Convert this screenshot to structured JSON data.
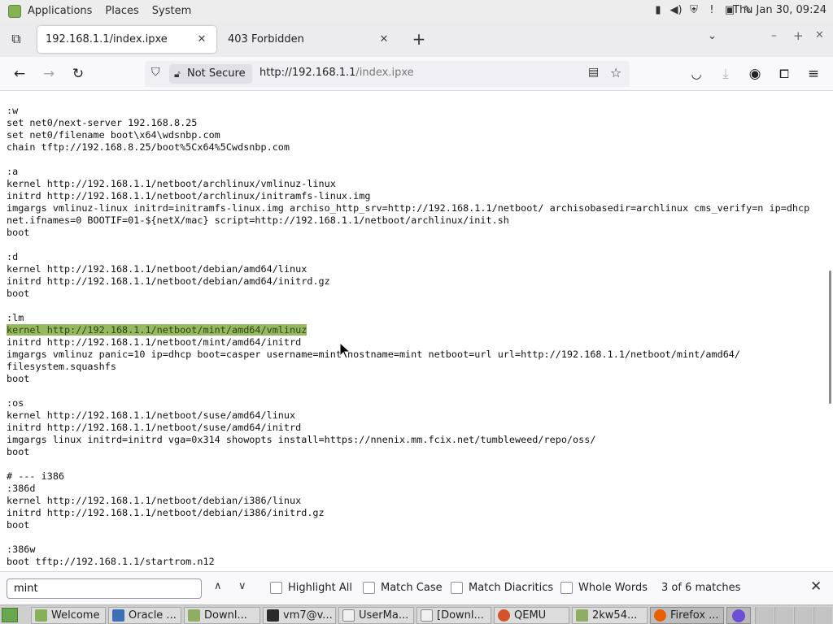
{
  "top_panel": {
    "menus": [
      "Applications",
      "Places",
      "System"
    ],
    "clock": "Thu Jan 30, 09:24",
    "tray_icons": [
      "network-icon",
      "volume-icon",
      "update-shield-icon",
      "notification-icon",
      "clipboard-icon",
      "pen-icon"
    ]
  },
  "tabs": [
    {
      "title": "192.168.1.1/index.ipxe",
      "active": true
    },
    {
      "title": "403 Forbidden",
      "active": false
    }
  ],
  "nav": {
    "not_secure": "Not Secure",
    "url_host": "http://192.168.1.1",
    "url_path": "/index.ipxe"
  },
  "page": {
    "lines": [
      ":w",
      "set net0/next-server 192.168.8.25",
      "set net0/filename boot\\x64\\wdsnbp.com",
      "chain tftp://192.168.8.25/boot%5Cx64%5Cwdsnbp.com",
      "",
      ":a",
      "kernel http://192.168.1.1/netboot/archlinux/vmlinuz-linux",
      "initrd http://192.168.1.1/netboot/archlinux/initramfs-linux.img",
      "imgargs vmlinuz-linux initrd=initramfs-linux.img archiso_http_srv=http://192.168.1.1/netboot/ archisobasedir=archlinux cms_verify=n ip=dhcp",
      "net.ifnames=0 BOOTIF=01-${netX/mac} script=http://192.168.1.1/netboot/archlinux/init.sh",
      "boot",
      "",
      ":d",
      "kernel http://192.168.1.1/netboot/debian/amd64/linux",
      "initrd http://192.168.1.1/netboot/debian/amd64/initrd.gz",
      "boot",
      "",
      ":lm",
      "kernel http://192.168.1.1/netboot/mint/amd64/vmlinuz",
      "initrd http://192.168.1.1/netboot/mint/amd64/initrd",
      "imgargs vmlinuz panic=10 ip=dhcp boot=casper username=mint hostname=mint netboot=url url=http://192.168.1.1/netboot/mint/amd64/",
      "filesystem.squashfs",
      "boot",
      "",
      ":os",
      "kernel http://192.168.1.1/netboot/suse/amd64/linux",
      "initrd http://192.168.1.1/netboot/suse/amd64/initrd",
      "imgargs linux initrd=initrd vga=0x314 showopts install=https://nnenix.mm.fcix.net/tumbleweed/repo/oss/",
      "boot",
      "",
      "# --- i386",
      ":386d",
      "kernel http://192.168.1.1/netboot/debian/i386/linux",
      "initrd http://192.168.1.1/netboot/debian/i386/initrd.gz",
      "boot",
      "",
      ":386w",
      "boot tftp://192.168.1.1/startrom.n12"
    ],
    "highlighted_line": 18
  },
  "find_bar": {
    "query": "mint",
    "highlight_all": "Highlight All",
    "match_case": "Match Case",
    "match_diacritics": "Match Diacritics",
    "whole_words": "Whole Words",
    "match_count": "3 of 6 matches"
  },
  "taskbar": {
    "items": [
      "Welcome",
      "Oracle ...",
      "Downl...",
      "vm7@v...",
      "UserMa...",
      "[Downl...",
      "QEMU",
      "2kw54...",
      "Firefox ..."
    ],
    "active_index": 8
  },
  "colors": {
    "find_highlight": "#96b85f",
    "mint_logo": "#87b158",
    "firefox_badge": "#6c4fd6"
  }
}
